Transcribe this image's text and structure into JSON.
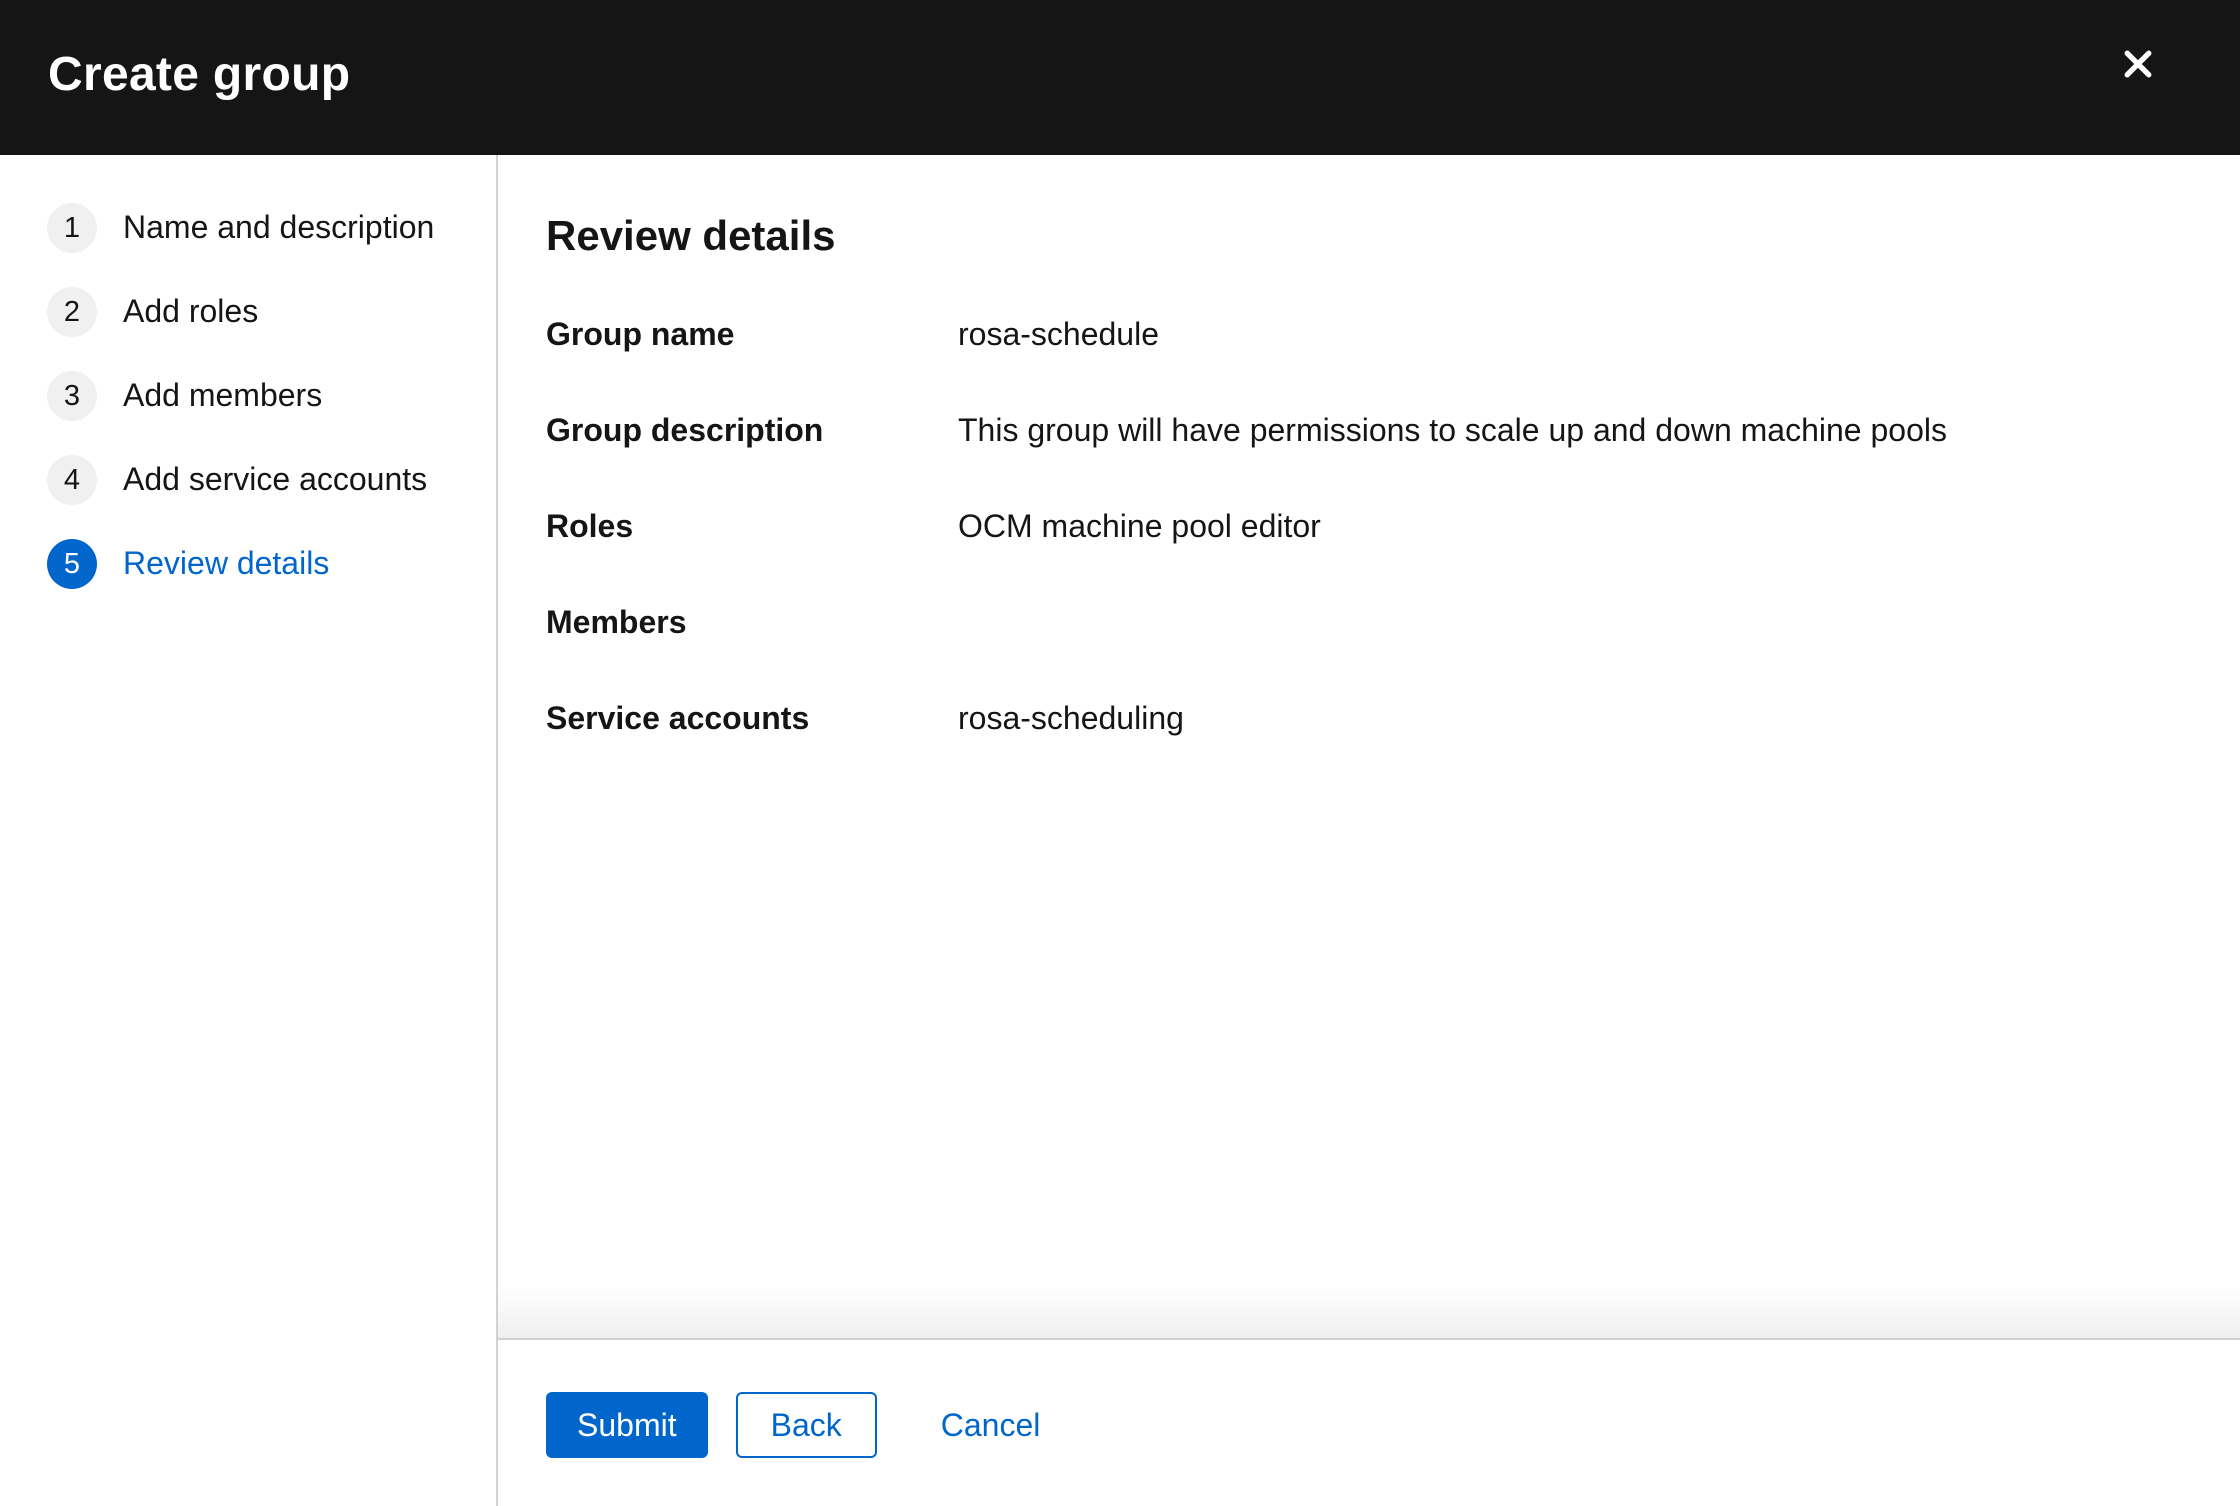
{
  "modal": {
    "title": "Create group"
  },
  "icons": {
    "close": "✕"
  },
  "wizard": {
    "steps": [
      {
        "number": "1",
        "label": "Name and description",
        "active": false
      },
      {
        "number": "2",
        "label": "Add roles",
        "active": false
      },
      {
        "number": "3",
        "label": "Add members",
        "active": false
      },
      {
        "number": "4",
        "label": "Add service accounts",
        "active": false
      },
      {
        "number": "5",
        "label": "Review details",
        "active": true
      }
    ]
  },
  "review": {
    "heading": "Review details",
    "rows": [
      {
        "label": "Group name",
        "value": "rosa-schedule"
      },
      {
        "label": "Group description",
        "value": "This group will have permissions to scale up and down machine pools"
      },
      {
        "label": "Roles",
        "value": "OCM machine pool editor"
      },
      {
        "label": "Members",
        "value": ""
      },
      {
        "label": "Service accounts",
        "value": "rosa-scheduling"
      }
    ]
  },
  "footer": {
    "submit_label": "Submit",
    "back_label": "Back",
    "cancel_label": "Cancel"
  },
  "colors": {
    "accent": "#0066cc",
    "header_bg": "#151515",
    "divider": "#d2d2d2",
    "step_inactive_bg": "#f0f0f0",
    "text": "#151515"
  }
}
